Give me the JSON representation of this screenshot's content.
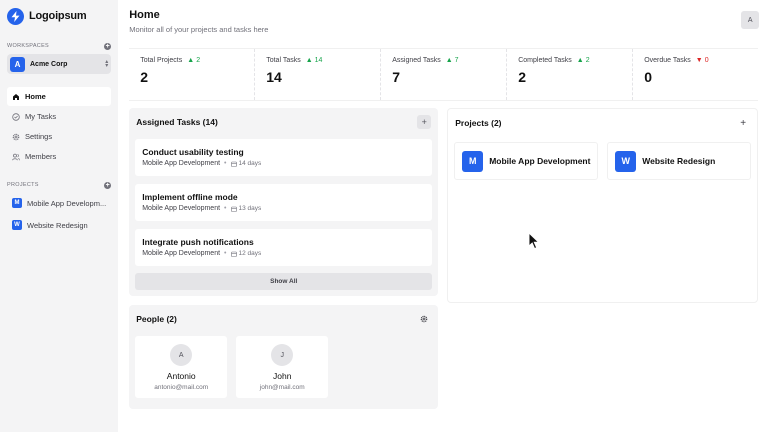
{
  "brand": {
    "name": "Logoipsum",
    "accent": "#2563eb"
  },
  "sidebar": {
    "workspaces_label": "WORKSPACES",
    "workspace": {
      "initial": "A",
      "name": "Acme Corp"
    },
    "nav": [
      {
        "label": "Home",
        "icon": "home-icon",
        "active": true
      },
      {
        "label": "My Tasks",
        "icon": "check-circle-icon",
        "active": false
      },
      {
        "label": "Settings",
        "icon": "gear-icon",
        "active": false
      },
      {
        "label": "Members",
        "icon": "users-icon",
        "active": false
      }
    ],
    "projects_label": "PROJECTS",
    "projects": [
      {
        "initial": "M",
        "name": "Mobile App Developm..."
      },
      {
        "initial": "W",
        "name": "Website Redesign"
      }
    ]
  },
  "header": {
    "title": "Home",
    "subtitle": "Monitor all of your projects and tasks here",
    "user_initial": "A"
  },
  "stats": [
    {
      "label": "Total Projects",
      "delta": "2",
      "direction": "up",
      "value": "2"
    },
    {
      "label": "Total Tasks",
      "delta": "14",
      "direction": "up",
      "value": "14"
    },
    {
      "label": "Assigned Tasks",
      "delta": "7",
      "direction": "up",
      "value": "7"
    },
    {
      "label": "Completed Tasks",
      "delta": "2",
      "direction": "up",
      "value": "2"
    },
    {
      "label": "Overdue Tasks",
      "delta": "0",
      "direction": "down",
      "value": "0"
    }
  ],
  "assigned_tasks": {
    "title": "Assigned Tasks (14)",
    "add_label": "+",
    "tasks": [
      {
        "title": "Conduct usability testing",
        "project": "Mobile App Development",
        "due": "14 days"
      },
      {
        "title": "Implement offline mode",
        "project": "Mobile App Development",
        "due": "13 days"
      },
      {
        "title": "Integrate push notifications",
        "project": "Mobile App Development",
        "due": "12 days"
      }
    ],
    "show_all": "Show All"
  },
  "people": {
    "title": "People (2)",
    "members": [
      {
        "initial": "A",
        "name": "Antonio",
        "email": "antonio@mail.com"
      },
      {
        "initial": "J",
        "name": "John",
        "email": "john@mail.com"
      }
    ]
  },
  "projects": {
    "title": "Projects (2)",
    "add_label": "+",
    "items": [
      {
        "initial": "M",
        "name": "Mobile App Development"
      },
      {
        "initial": "W",
        "name": "Website Redesign"
      }
    ]
  },
  "colors": {
    "up": "#16a34a",
    "down": "#dc2626",
    "sidebar_bg": "#f4f4f5",
    "panel_bg": "#f4f4f5"
  }
}
